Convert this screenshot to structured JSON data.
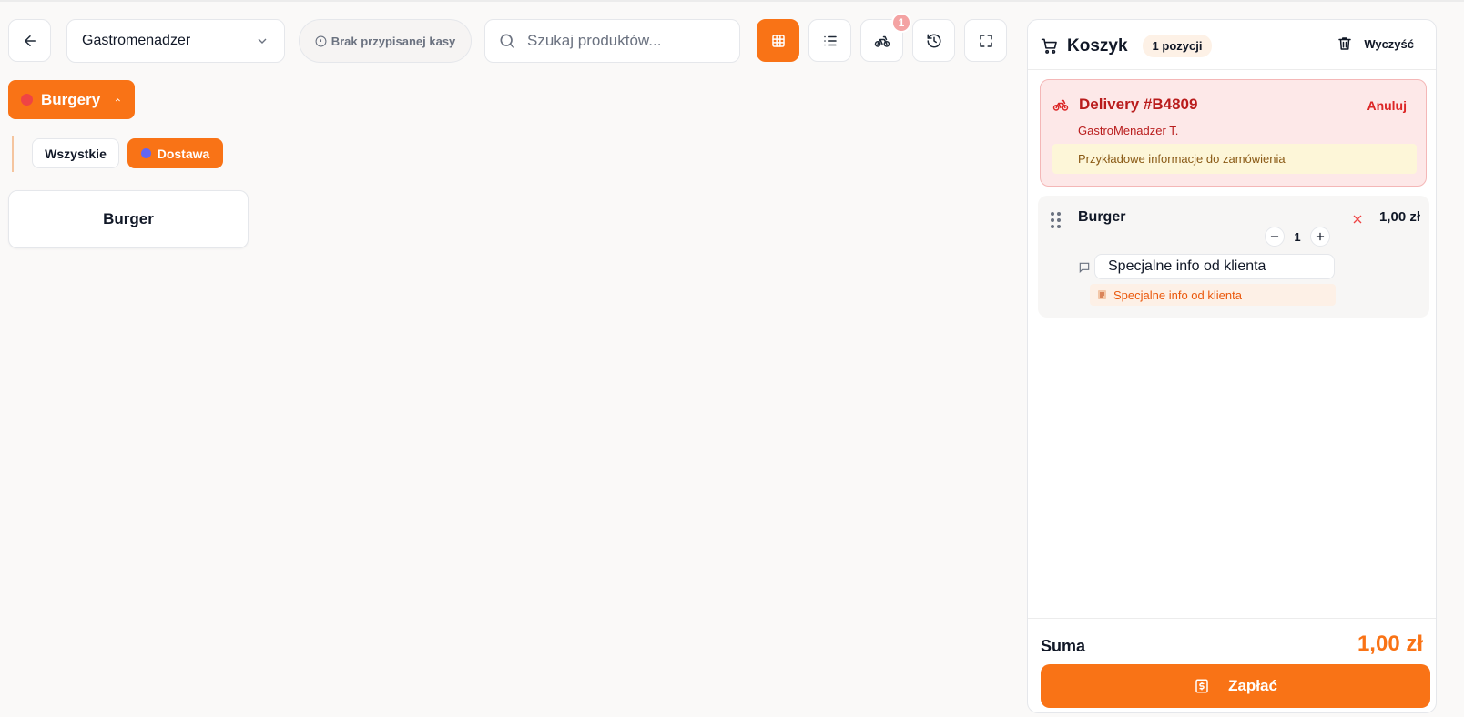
{
  "toolbar": {
    "back_icon": "arrow-left-icon",
    "location_select": {
      "value": "Gastromenadzer"
    },
    "register_status": "Brak przypisanej kasy",
    "search": {
      "placeholder": "Szukaj produktów..."
    },
    "view_buttons": [
      {
        "icon": "grid-icon",
        "active": true
      },
      {
        "icon": "list-icon",
        "active": false
      },
      {
        "icon": "bike-icon",
        "active": false,
        "badge": "1"
      },
      {
        "icon": "history-icon",
        "active": false
      },
      {
        "icon": "fullscreen-icon",
        "active": false
      }
    ]
  },
  "categories": {
    "active": {
      "label": "Burgery",
      "color": "#ef4444"
    },
    "subcategories": [
      {
        "label": "Wszystkie",
        "active": false
      },
      {
        "label": "Dostawa",
        "active": true,
        "color": "#6366f1"
      }
    ]
  },
  "products": [
    {
      "name": "Burger"
    }
  ],
  "cart": {
    "title": "Koszyk",
    "count": "1 pozycji",
    "clear_label": "Wyczyść",
    "delivery": {
      "title": "Delivery #B4809",
      "cancel_label": "Anuluj",
      "customer": "GastroMenadzer T.",
      "note": "Przykładowe informacje do zamówienia"
    },
    "items": [
      {
        "name": "Burger",
        "quantity": "1",
        "price": "1,00 zł",
        "note_input": "Specjalne info od klienta",
        "note_display": "Specjalne info od klienta"
      }
    ],
    "sum_label": "Suma",
    "sum_value": "1,00 zł",
    "pay_label": "Zapłać"
  },
  "colors": {
    "accent": "#f97316",
    "danger": "#dc2626",
    "background": "#faf9f8"
  }
}
